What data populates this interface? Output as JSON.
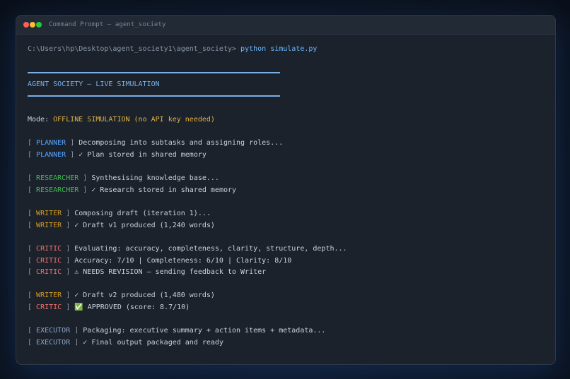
{
  "window": {
    "title": "Command Prompt — agent_society"
  },
  "terminal": {
    "prompt": "C:\\Users\\hp\\Desktop\\agent_society1\\agent_society>",
    "command": "python simulate.py",
    "banner": "AGENT SOCIETY — LIVE SIMULATION",
    "mode_label": "Mode:",
    "mode_value": "OFFLINE SIMULATION (no API key needed)",
    "lines": [
      {
        "agent": "PLANNER",
        "text": "Decomposing into subtasks and assigning roles..."
      },
      {
        "agent": "PLANNER",
        "text": "✓ Plan stored in shared memory"
      },
      {
        "agent": "RESEARCHER",
        "text": "Synthesising knowledge base..."
      },
      {
        "agent": "RESEARCHER",
        "text": "✓ Research stored in shared memory"
      },
      {
        "agent": "WRITER",
        "text": "Composing draft (iteration 1)..."
      },
      {
        "agent": "WRITER",
        "text": "✓ Draft v1 produced (1,240 words)"
      },
      {
        "agent": "CRITIC",
        "text": "Evaluating: accuracy, completeness, clarity, structure, depth..."
      },
      {
        "agent": "CRITIC",
        "text": "Accuracy: 7/10 | Completeness: 6/10 | Clarity: 8/10"
      },
      {
        "agent": "CRITIC",
        "text": "⚠ NEEDS REVISION — sending feedback to Writer"
      },
      {
        "agent": "WRITER",
        "text": "✓ Draft v2 produced (1,480 words)"
      },
      {
        "agent": "CRITIC",
        "text": "✅ APPROVED (score: 8.7/10)"
      },
      {
        "agent": "EXECUTOR",
        "text": "Packaging: executive summary + action items + metadata..."
      },
      {
        "agent": "EXECUTOR",
        "text": "✓ Final output packaged and ready"
      }
    ]
  },
  "colors": {
    "planner": "#58a6ff",
    "researcher": "#3fb950",
    "writer": "#d29922",
    "critic": "#f47067",
    "executor": "#8ba4c8",
    "banner": "#79b0e8",
    "mode": "#e3b341"
  }
}
